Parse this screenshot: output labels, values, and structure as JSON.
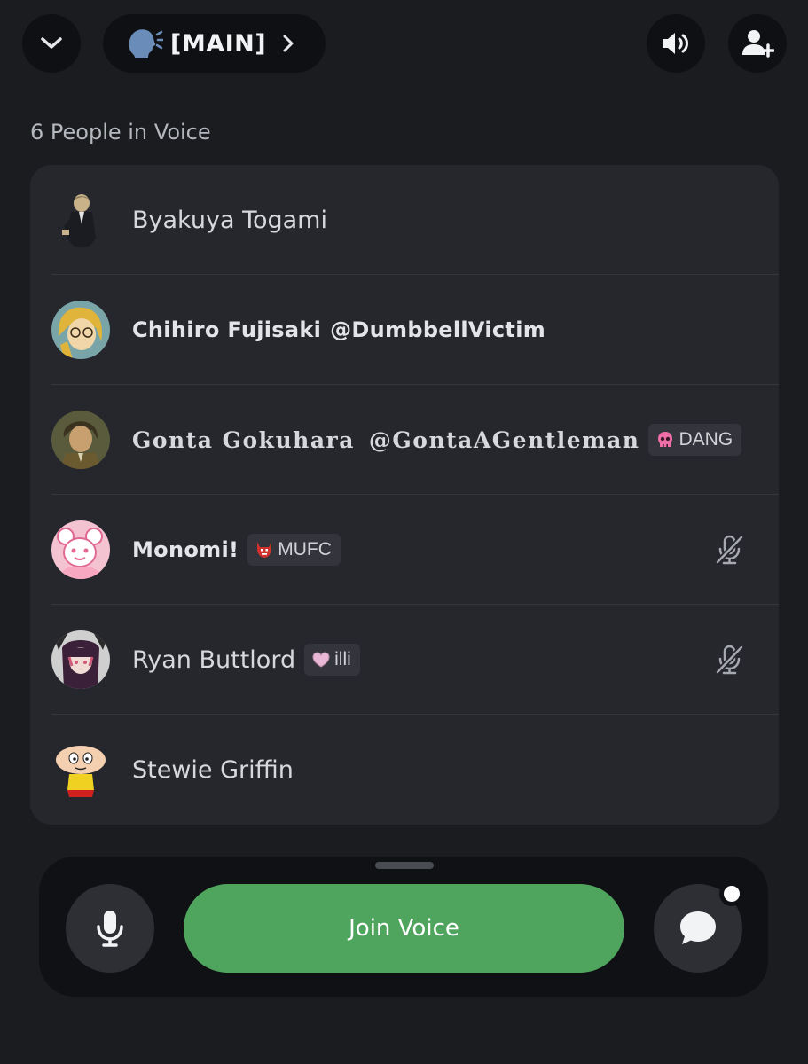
{
  "header": {
    "channel_emoji": "speaking-head-icon",
    "channel_name": "[MAIN]",
    "back_icon": "chevron-down-icon",
    "speaker_icon": "speaker-icon",
    "invite_icon": "add-user-icon"
  },
  "voice": {
    "count_label": "6 People in Voice",
    "participants": [
      {
        "name": "Byakuya Togami",
        "handle": "",
        "tag": "",
        "muted": false
      },
      {
        "name": "Chihiro Fujisaki",
        "handle": "@DumbbellVictim",
        "tag": "",
        "muted": false
      },
      {
        "name": "Gonta Gokuhara",
        "handle": "@GontaAGentleman",
        "tag": "DANG",
        "tag_icon": "skull-icon",
        "muted": false
      },
      {
        "name": "Monomi!",
        "handle": "",
        "tag": "MUFC",
        "tag_icon": "devil-icon",
        "muted": true
      },
      {
        "name": "Ryan Buttlord",
        "handle": "",
        "tag": "illi",
        "tag_icon": "heart-icon",
        "muted": true
      },
      {
        "name": "Stewie Griffin",
        "handle": "",
        "tag": "",
        "muted": false
      }
    ]
  },
  "controls": {
    "join_label": "Join Voice",
    "mic_icon": "microphone-icon",
    "chat_icon": "chat-bubble-icon"
  },
  "colors": {
    "background": "#1b1c20",
    "card": "#26272d",
    "join_green": "#4fa55e"
  }
}
